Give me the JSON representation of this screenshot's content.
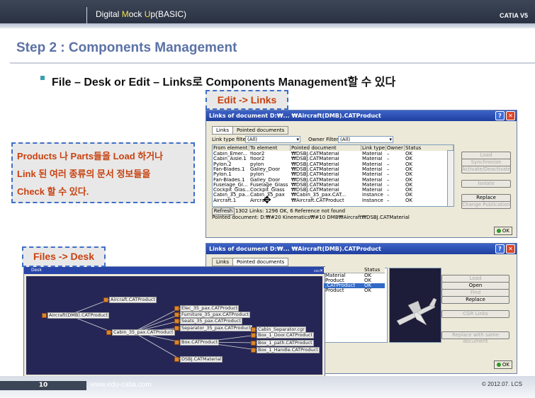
{
  "header": {
    "title_pre": "Digital ",
    "title_m": "M",
    "title_mid": "ock ",
    "title_u": "U",
    "title_post": "p(BASIC)",
    "brand": "CATIA V5"
  },
  "slide": {
    "step_title": "Step 2 : Components Management",
    "bullet": "File – Desk or Edit – Links로 Components Management할 수 있다",
    "edit_callout": "Edit -> Links",
    "files_callout": "Files -> Desk",
    "note_lines": [
      "Products 나 Parts들을 Load 하거나",
      "Link 된 여러 종류의 문서 정보들을",
      "Check 할 수 있다."
    ]
  },
  "links_window": {
    "title": "Links of document D:₩... ₩Aircraft(DMB).CATProduct",
    "tabs": [
      "Links",
      "Pointed documents"
    ],
    "link_type_filter_label": "Link type filter:",
    "link_type_filter_value": "(All)",
    "owner_filter_label": "Owner Filter:",
    "owner_filter_value": "(All)",
    "columns": [
      "From element",
      "To element",
      "Pointed document",
      "Link type",
      "Owner",
      "Status"
    ],
    "rows": [
      [
        "Cabin_Emer...",
        "floor2",
        "₩DSBJ.CATMaterial",
        "Material",
        "–",
        "OK"
      ],
      [
        "Cabin_Aisle.1",
        "floor2",
        "₩DSBJ.CATMaterial",
        "Material",
        "–",
        "OK"
      ],
      [
        "Pylon.2",
        "pylon",
        "₩DSBJ.CATMaterial",
        "Material",
        "–",
        "OK"
      ],
      [
        "Fan-Blades.1",
        "Galley_Door",
        "₩DSBJ.CATMaterial",
        "Material",
        "–",
        "OK"
      ],
      [
        "Pylon.1",
        "pylon",
        "₩DSBJ.CATMaterial",
        "Material",
        "–",
        "OK"
      ],
      [
        "Fan-Blades.1",
        "Galley_Door",
        "₩DSBJ.CATMaterial",
        "Material",
        "–",
        "OK"
      ],
      [
        "Fuselage_Gl...",
        "Fuselage_Glass",
        "₩DSBJ.CATMaterial",
        "Material",
        "–",
        "OK"
      ],
      [
        "Cockpit_Glas...",
        "Cockpit_Glass",
        "₩DSBJ.CATMaterial",
        "Material",
        "–",
        "OK"
      ],
      [
        "Cabin_35_pa...",
        "Cabin_35_pax",
        "₩Cabin_35_pax.CAT...",
        "Instance",
        "–",
        "OK"
      ],
      [
        "Aircraft.1",
        "Aircraft",
        "₩Aircraft.CATProduct",
        "Instance",
        "–",
        "OK"
      ]
    ],
    "side_buttons": [
      "Load",
      "Synchronize",
      "Activate/Deactivate",
      "Isolate",
      "Replace",
      "Change Publication"
    ],
    "refresh": "Refresh",
    "status_text": "1302 Links: 1296 OK, 6 Reference not found",
    "pointed_doc": "Pointed document: D:₩#20 Kinematics₩#10 DMB₩Aircraft₩DSBJ.CATMaterial",
    "ok": "OK"
  },
  "pointed_window": {
    "title": "Links of document D:₩... ₩Aircraft(DMB).CATProduct",
    "tabs": [
      "Links",
      "Pointed documents"
    ],
    "columns": [
      "",
      "Status"
    ],
    "rows": [
      [
        "Material",
        "OK"
      ],
      [
        "Product",
        "OK"
      ],
      [
        ".CATProduct",
        "OK"
      ],
      [
        "Product",
        "OK"
      ]
    ],
    "buttons": [
      "Load",
      "Open",
      "Find",
      "Replace",
      "CGR Links",
      "Replace with same document"
    ],
    "ok": "OK"
  },
  "desk": {
    "title": "Desk",
    "nodes": [
      "Aircraft(DMB).CATProduct",
      "Aircraft.CATProduct",
      "Cabin_35_pax.CATProduct",
      "Elec_35_pax.CATProduct",
      "Furniture_35_pax.CATProduct",
      "Seats_35_pax.CATProduct",
      "Separator_35_pax.CATProduct",
      "Box.CATProduct",
      "DSBJ.CATMaterial",
      "Cabin_Separator.cgr",
      "Box_1_Door.CATProduct",
      "Box_1_path.CATProduct",
      "Box_1_Handle.CATProduct"
    ]
  },
  "footer": {
    "page": "10",
    "url": "www.edu-catia.com",
    "copyright": "© 2012.07. LCS"
  }
}
